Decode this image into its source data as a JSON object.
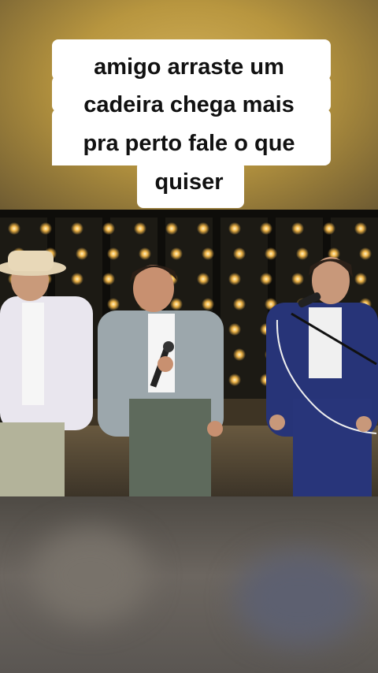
{
  "caption": {
    "lines": [
      "amigo arraste um",
      "cadeira chega mais",
      "pra perto fale o que",
      "quiser"
    ]
  },
  "colors": {
    "caption_bg": "#ffffff",
    "caption_text": "#111111",
    "top_background": "#c9a955",
    "video_background": "#0c0b08"
  },
  "video": {
    "description_icon": "video-frame"
  }
}
